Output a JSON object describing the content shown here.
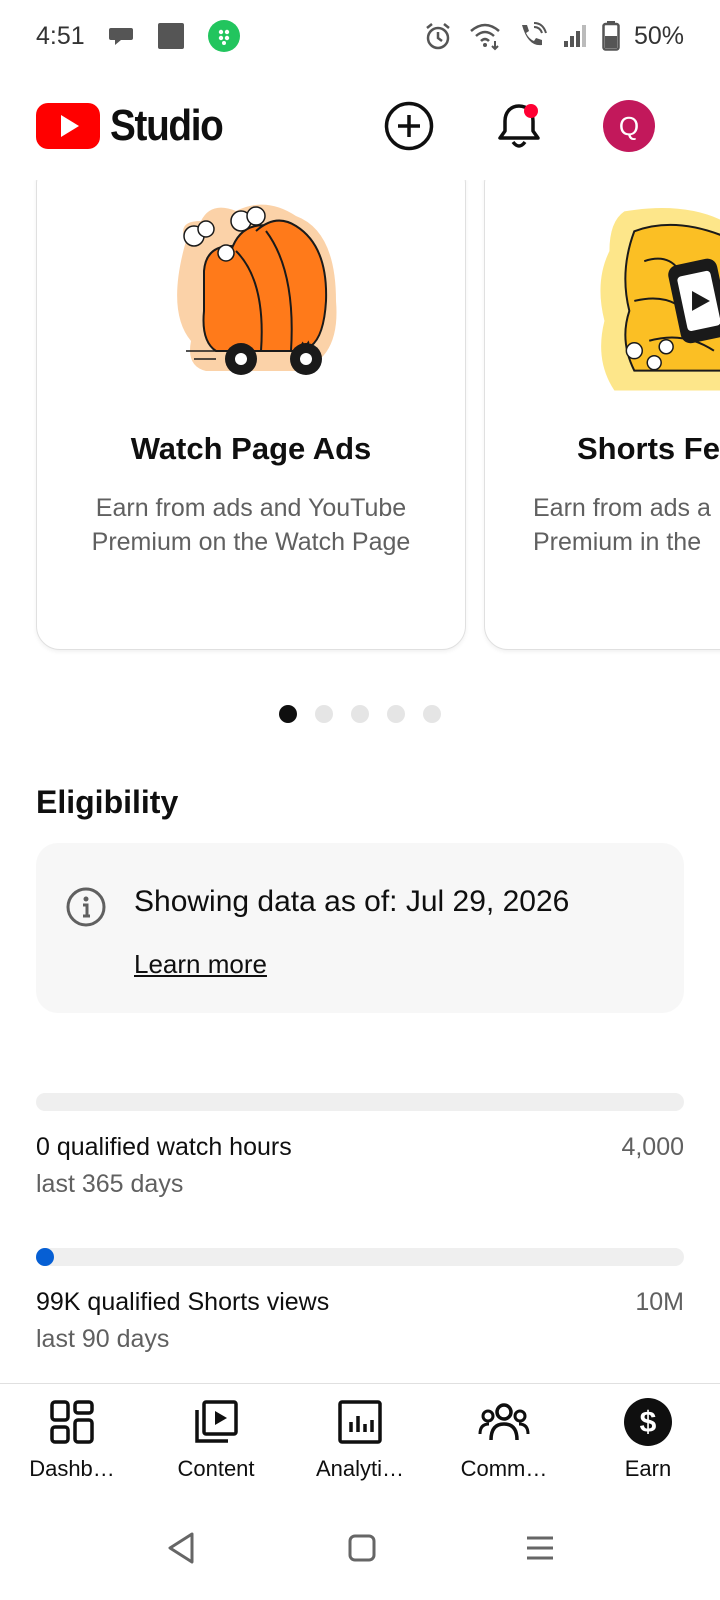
{
  "status_bar": {
    "time": "4:51",
    "battery": "50%",
    "icons_left": [
      "chat-bubble-icon",
      "square-app-icon",
      "green-app-icon"
    ],
    "icons_right": [
      "alarm-icon",
      "wifi-icon",
      "wifi-calling-icon",
      "signal-icon",
      "battery-icon"
    ]
  },
  "app_bar": {
    "logo_text": "Studio",
    "logo_color": "#ff0000",
    "avatar_initial": "Q",
    "avatar_color": "#c2185b",
    "notification_dot_color": "#ff0033"
  },
  "carousel": {
    "cards": [
      {
        "title": "Watch Page Ads",
        "description": "Earn from ads and YouTube Premium on the Watch Page",
        "illustration": "orange-cart-illustration"
      },
      {
        "title": "Shorts Fe",
        "description_line1": "Earn from ads a",
        "description_line2": "Premium in the",
        "illustration": "yellow-shorts-illustration"
      }
    ],
    "active_page": 1,
    "page_count": 5
  },
  "eligibility": {
    "title": "Eligibility",
    "info_text": "Showing data as of: Jul 29, 2026",
    "learn_more": "Learn more"
  },
  "metrics": [
    {
      "label": "0 qualified watch hours",
      "period": "last 365 days",
      "target": "4,000",
      "progress": 0
    },
    {
      "label": "99K qualified Shorts views",
      "period": "last 90 days",
      "target": "10M",
      "progress": 0.0099
    }
  ],
  "bottom_nav": {
    "items": [
      {
        "label": "Dashb…",
        "icon": "dashboard-icon"
      },
      {
        "label": "Content",
        "icon": "content-icon"
      },
      {
        "label": "Analyti…",
        "icon": "analytics-icon"
      },
      {
        "label": "Comm…",
        "icon": "community-icon"
      },
      {
        "label": "Earn",
        "icon": "earn-icon"
      }
    ],
    "active_index": 4
  },
  "system_nav": {
    "icons": [
      "back-icon",
      "home-icon",
      "recents-icon"
    ]
  }
}
